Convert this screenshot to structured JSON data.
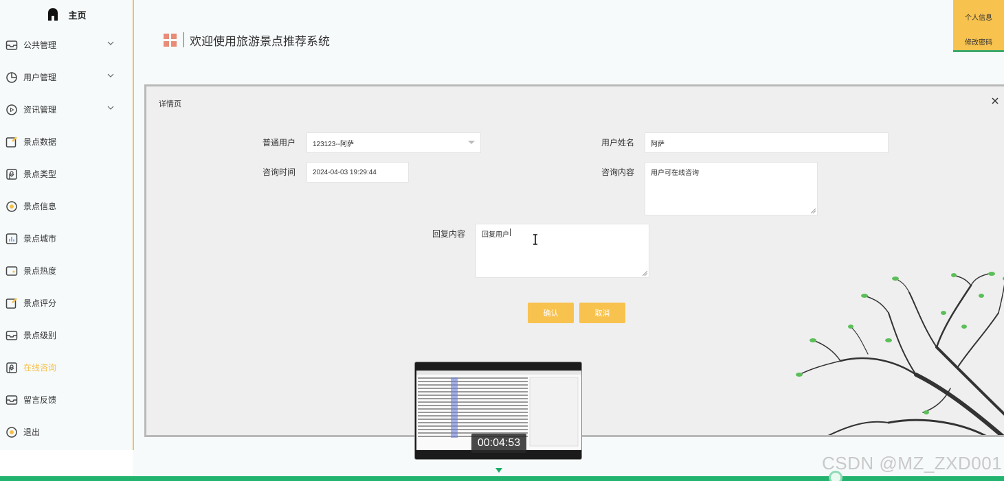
{
  "sidebar": {
    "home_label": "主页",
    "items": [
      {
        "label": "公共管理",
        "icon": "inbox-icon",
        "has_chevron": true
      },
      {
        "label": "用户管理",
        "icon": "pie-chart-icon",
        "has_chevron": true
      },
      {
        "label": "资讯管理",
        "icon": "play-circle-icon",
        "has_chevron": true
      },
      {
        "label": "景点数据",
        "icon": "edit-icon",
        "has_chevron": false
      },
      {
        "label": "景点类型",
        "icon": "bookmark-icon",
        "has_chevron": false
      },
      {
        "label": "景点信息",
        "icon": "sun-icon",
        "has_chevron": false
      },
      {
        "label": "景点城市",
        "icon": "bar-chart-icon",
        "has_chevron": false
      },
      {
        "label": "景点热度",
        "icon": "wallet-icon",
        "has_chevron": false
      },
      {
        "label": "景点评分",
        "icon": "edit-icon",
        "has_chevron": false
      },
      {
        "label": "景点级别",
        "icon": "inbox-icon",
        "has_chevron": false
      },
      {
        "label": "在线咨询",
        "icon": "bookmark-icon",
        "has_chevron": false,
        "active": true
      },
      {
        "label": "留言反馈",
        "icon": "inbox-icon",
        "has_chevron": false
      },
      {
        "label": "退出",
        "icon": "sun-icon",
        "has_chevron": false
      }
    ]
  },
  "header": {
    "title": "欢迎使用旅游景点推荐系统",
    "user_menu": {
      "profile": "个人信息",
      "change_password": "修改密码"
    }
  },
  "panel": {
    "title": "详情页",
    "fields": {
      "user_label": "普通用户",
      "user_value": "123123--阿萨",
      "name_label": "用户姓名",
      "name_value": "阿萨",
      "time_label": "咨询时间",
      "time_value": "2024-04-03 19:29:44",
      "content_label": "咨询内容",
      "content_value": "用户可在线咨询",
      "reply_label": "回复内容",
      "reply_value": "回复用户"
    },
    "confirm": "确认",
    "cancel": "取消"
  },
  "video": {
    "timestamp": "00:04:53"
  },
  "watermark": "CSDN @MZ_ZXD001",
  "colors": {
    "accent": "#f8c24e",
    "progress": "#22b36e",
    "brand_icon": "#e98b77"
  }
}
